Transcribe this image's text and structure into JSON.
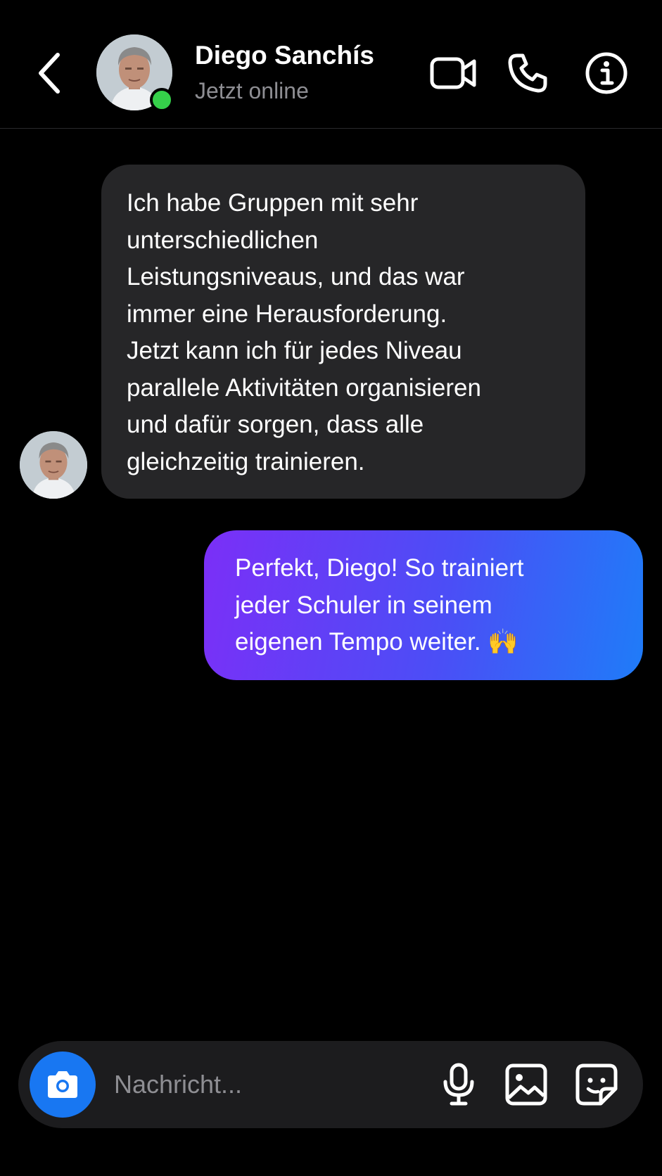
{
  "header": {
    "contact_name": "Diego Sanchís",
    "status": "Jetzt online"
  },
  "messages": [
    {
      "direction": "incoming",
      "lines": [
        "Ich habe Gruppen mit sehr",
        "unterschiedlichen",
        "Leistungsniveaus, und das war",
        "immer eine Herausforderung.",
        "Jetzt kann ich für jedes Niveau",
        "parallele Aktivitäten organisieren",
        "und dafür sorgen, dass alle",
        "gleichzeitig trainieren."
      ]
    },
    {
      "direction": "outgoing",
      "lines": [
        "Perfekt, Diego! So trainiert",
        "jeder Schuler in seinem",
        "eigenen Tempo weiter. 🙌"
      ]
    }
  ],
  "composer": {
    "placeholder": "Nachricht..."
  },
  "icons": {
    "back": "chevron-left-icon",
    "video": "video-camera-icon",
    "phone": "phone-icon",
    "info": "info-icon",
    "camera": "camera-icon",
    "mic": "microphone-icon",
    "gallery": "image-icon",
    "sticker": "sticker-icon"
  },
  "colors": {
    "background": "#000000",
    "incoming_bubble": "#262628",
    "outgoing_gradient_start": "#7b2ff7",
    "outgoing_gradient_end": "#1f7cf8",
    "online_indicator": "#35d04a",
    "camera_button": "#1877f2",
    "secondary_text": "#8e8e93"
  }
}
